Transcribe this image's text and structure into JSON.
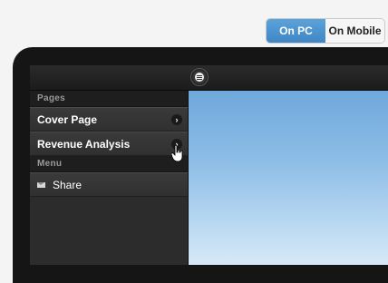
{
  "view_toggle": {
    "pc_label": "On PC",
    "mobile_label": "On Mobile",
    "active": "On PC"
  },
  "sidebar": {
    "pages_header": "Pages",
    "pages": [
      {
        "label": "Cover Page"
      },
      {
        "label": "Revenue Analysis"
      }
    ],
    "menu_header": "Menu",
    "menu": [
      {
        "label": "Share",
        "icon": "mail-icon"
      }
    ]
  },
  "colors": {
    "accent": "#4a94d0",
    "panel_bg": "#2c2c2c",
    "content_sky": "#8dbde6"
  }
}
